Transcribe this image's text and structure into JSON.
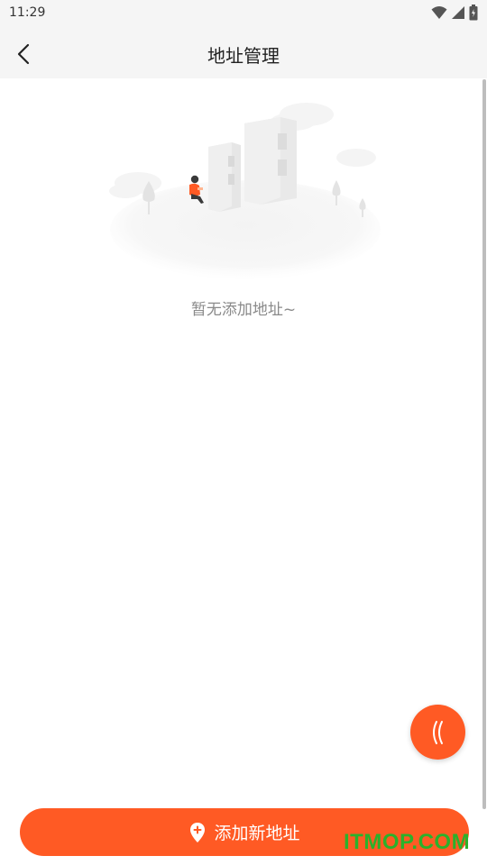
{
  "status": {
    "time": "11:29",
    "icons": [
      "wifi-icon",
      "signal-icon",
      "battery-icon"
    ]
  },
  "header": {
    "title": "地址管理",
    "back_icon": "chevron-left-icon"
  },
  "empty_state": {
    "message": "暂无添加地址~",
    "illustration": "city-empty-illustration"
  },
  "fab": {
    "icon": "double-chevron-left-icon"
  },
  "footer": {
    "add_label": "添加新地址",
    "add_icon": "location-plus-icon"
  },
  "watermark": {
    "text": "ITMOP.COM"
  },
  "colors": {
    "accent": "#ff5a24",
    "header_bg": "#f5f5f5",
    "muted_text": "#8a8a8a",
    "watermark": "#2bb12b"
  }
}
